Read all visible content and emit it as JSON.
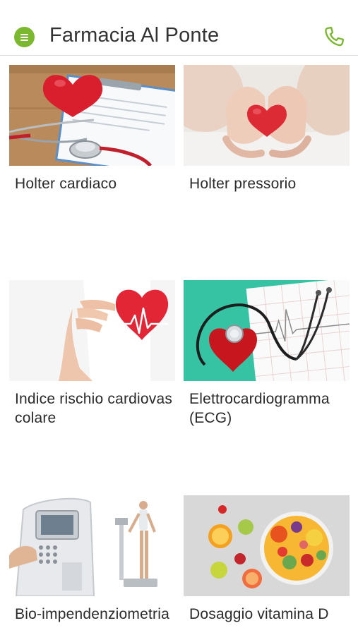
{
  "header": {
    "title": "Farmacia Al Ponte",
    "menu_icon": "menu-icon",
    "phone_icon": "phone-icon",
    "accent_color": "#7cb82f"
  },
  "services": [
    {
      "label": "Holter cardiaco",
      "image": "heart-stethoscope-clipboard-image"
    },
    {
      "label": "Holter pressorio",
      "image": "hands-holding-heart-image"
    },
    {
      "label": "Indice rischio cardiovascolare",
      "image": "hand-heart-ecg-image"
    },
    {
      "label": "Elettrocardiogramma (ECG)",
      "image": "stethoscope-heart-ecg-paper-image"
    },
    {
      "label": "Bio-impendenziometria",
      "image": "bioimpedance-machine-image"
    },
    {
      "label": "Dosaggio vitamina D",
      "image": "fruit-bowl-image"
    }
  ]
}
